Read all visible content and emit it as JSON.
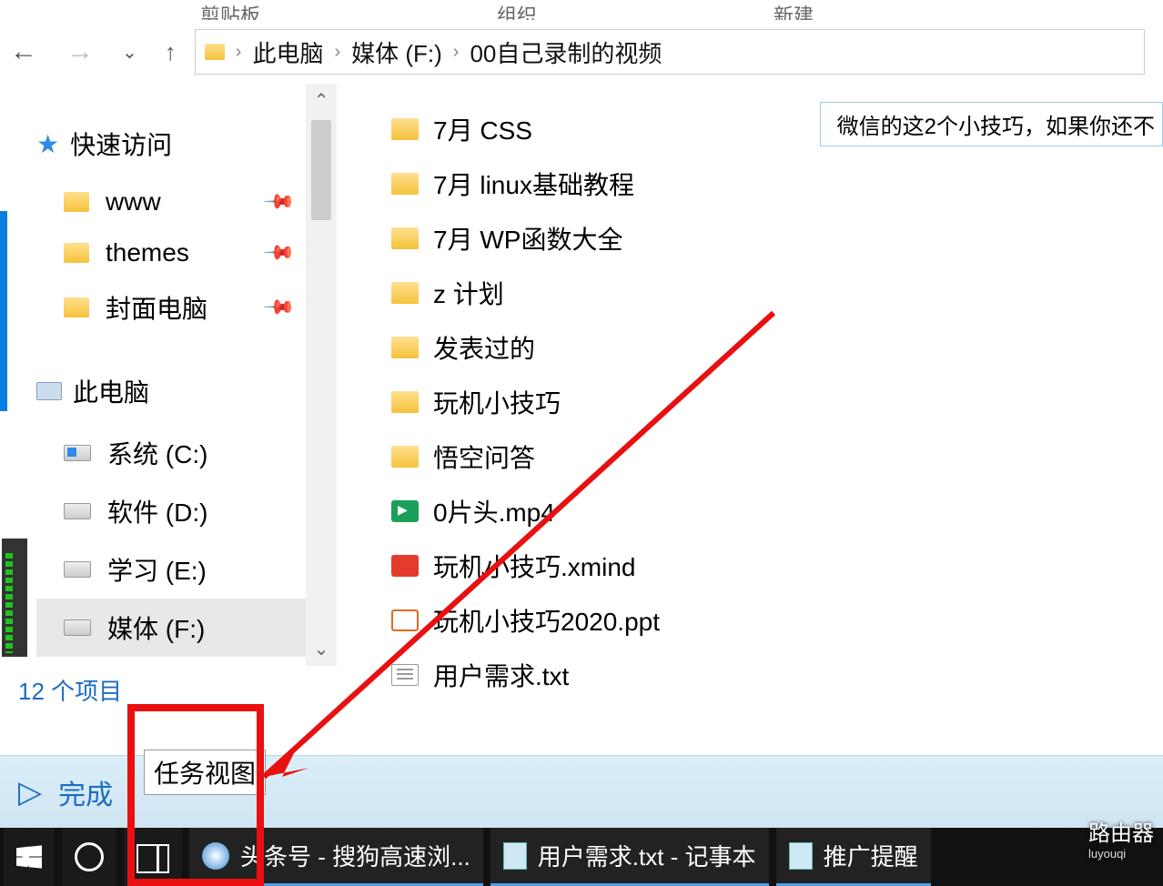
{
  "ribbon": {
    "tab1": "剪贴板",
    "tab2": "组织",
    "tab3": "新建"
  },
  "breadcrumb": {
    "pc": "此电脑",
    "drive": "媒体 (F:)",
    "folder": "00自己录制的视频"
  },
  "sidebar": {
    "quick": "快速访问",
    "pins": [
      "www",
      "themes",
      "封面电脑"
    ],
    "this_pc": "此电脑",
    "drives": [
      "系统 (C:)",
      "软件 (D:)",
      "学习 (E:)",
      "媒体 (F:)"
    ]
  },
  "files": {
    "folders": [
      "7月 CSS",
      "7月 linux基础教程",
      "7月 WP函数大全",
      "z 计划",
      "发表过的",
      "玩机小技巧",
      "悟空问答"
    ],
    "items": [
      {
        "name": "0片头.mp4",
        "type": "mp4"
      },
      {
        "name": "玩机小技巧.xmind",
        "type": "xmind"
      },
      {
        "name": "玩机小技巧2020.ppt",
        "type": "ppt"
      },
      {
        "name": "用户需求.txt",
        "type": "txt"
      }
    ],
    "extra": "微信的这2个小技巧，如果你还不"
  },
  "status": "12 个项目",
  "player": {
    "done": "完成"
  },
  "tooltip": "任务视图",
  "taskbar": {
    "browser": "头条号 - 搜狗高速浏...",
    "notepad": "用户需求.txt - 记事本",
    "app3": "推广提醒"
  },
  "watermark": {
    "main": "路由器",
    "sub": "luyouqi"
  }
}
